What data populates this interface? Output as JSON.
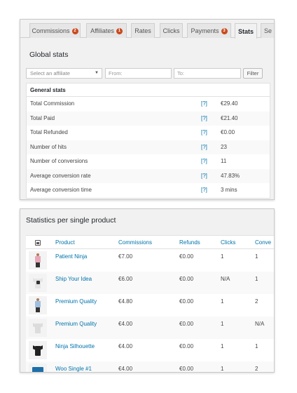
{
  "tabs": [
    {
      "label": "Commissions",
      "badge": "2"
    },
    {
      "label": "Affiliates",
      "badge": "1"
    },
    {
      "label": "Rates",
      "badge": ""
    },
    {
      "label": "Clicks",
      "badge": ""
    },
    {
      "label": "Payments",
      "badge": "3"
    },
    {
      "label": "Stats",
      "badge": ""
    },
    {
      "label": "Se",
      "badge": ""
    }
  ],
  "global": {
    "title": "Global stats",
    "filter": {
      "affiliate_placeholder": "Select an affiliate",
      "from_placeholder": "From:",
      "to_placeholder": "To:",
      "filter_label": "Filter"
    },
    "table_header": "General stats",
    "help_label": "[?]",
    "rows": [
      {
        "label": "Total Commission",
        "value": "€29.40"
      },
      {
        "label": "Total Paid",
        "value": "€21.40"
      },
      {
        "label": "Total Refunded",
        "value": "€0.00"
      },
      {
        "label": "Number of hits",
        "value": "23"
      },
      {
        "label": "Number of conversions",
        "value": "11"
      },
      {
        "label": "Average conversion rate",
        "value": "47.83%"
      },
      {
        "label": "Average conversion time",
        "value": "3 mins"
      }
    ]
  },
  "per_product": {
    "title": "Statistics per single product",
    "columns": {
      "product": "Product",
      "commissions": "Commissions",
      "refunds": "Refunds",
      "clicks": "Clicks",
      "conversions": "Conve"
    },
    "rows": [
      {
        "name": "Patient Ninja",
        "commissions": "€7.00",
        "refunds": "€0.00",
        "clicks": "1",
        "conversions": "1",
        "thumb": "person-pink-icon"
      },
      {
        "name": "Ship Your Idea",
        "commissions": "€6.00",
        "refunds": "€0.00",
        "clicks": "N/A",
        "conversions": "1",
        "thumb": "tshirt-white-print-icon"
      },
      {
        "name": "Premium Quality",
        "commissions": "€4.80",
        "refunds": "€0.00",
        "clicks": "1",
        "conversions": "2",
        "thumb": "person-blue-icon"
      },
      {
        "name": "Premium Quality",
        "commissions": "€4.00",
        "refunds": "€0.00",
        "clicks": "1",
        "conversions": "N/A",
        "thumb": "tshirt-white-icon"
      },
      {
        "name": "Ninja Silhouette",
        "commissions": "€4.00",
        "refunds": "€0.00",
        "clicks": "1",
        "conversions": "1",
        "thumb": "tshirt-black-icon"
      },
      {
        "name": "Woo Single #1",
        "commissions": "€4.00",
        "refunds": "€0.00",
        "clicks": "1",
        "conversions": "2",
        "thumb": "album-blue-icon"
      }
    ]
  },
  "colors": {
    "link": "#0073aa",
    "badge": "#ca4a1f",
    "panel_bg": "#f1f1f1"
  }
}
